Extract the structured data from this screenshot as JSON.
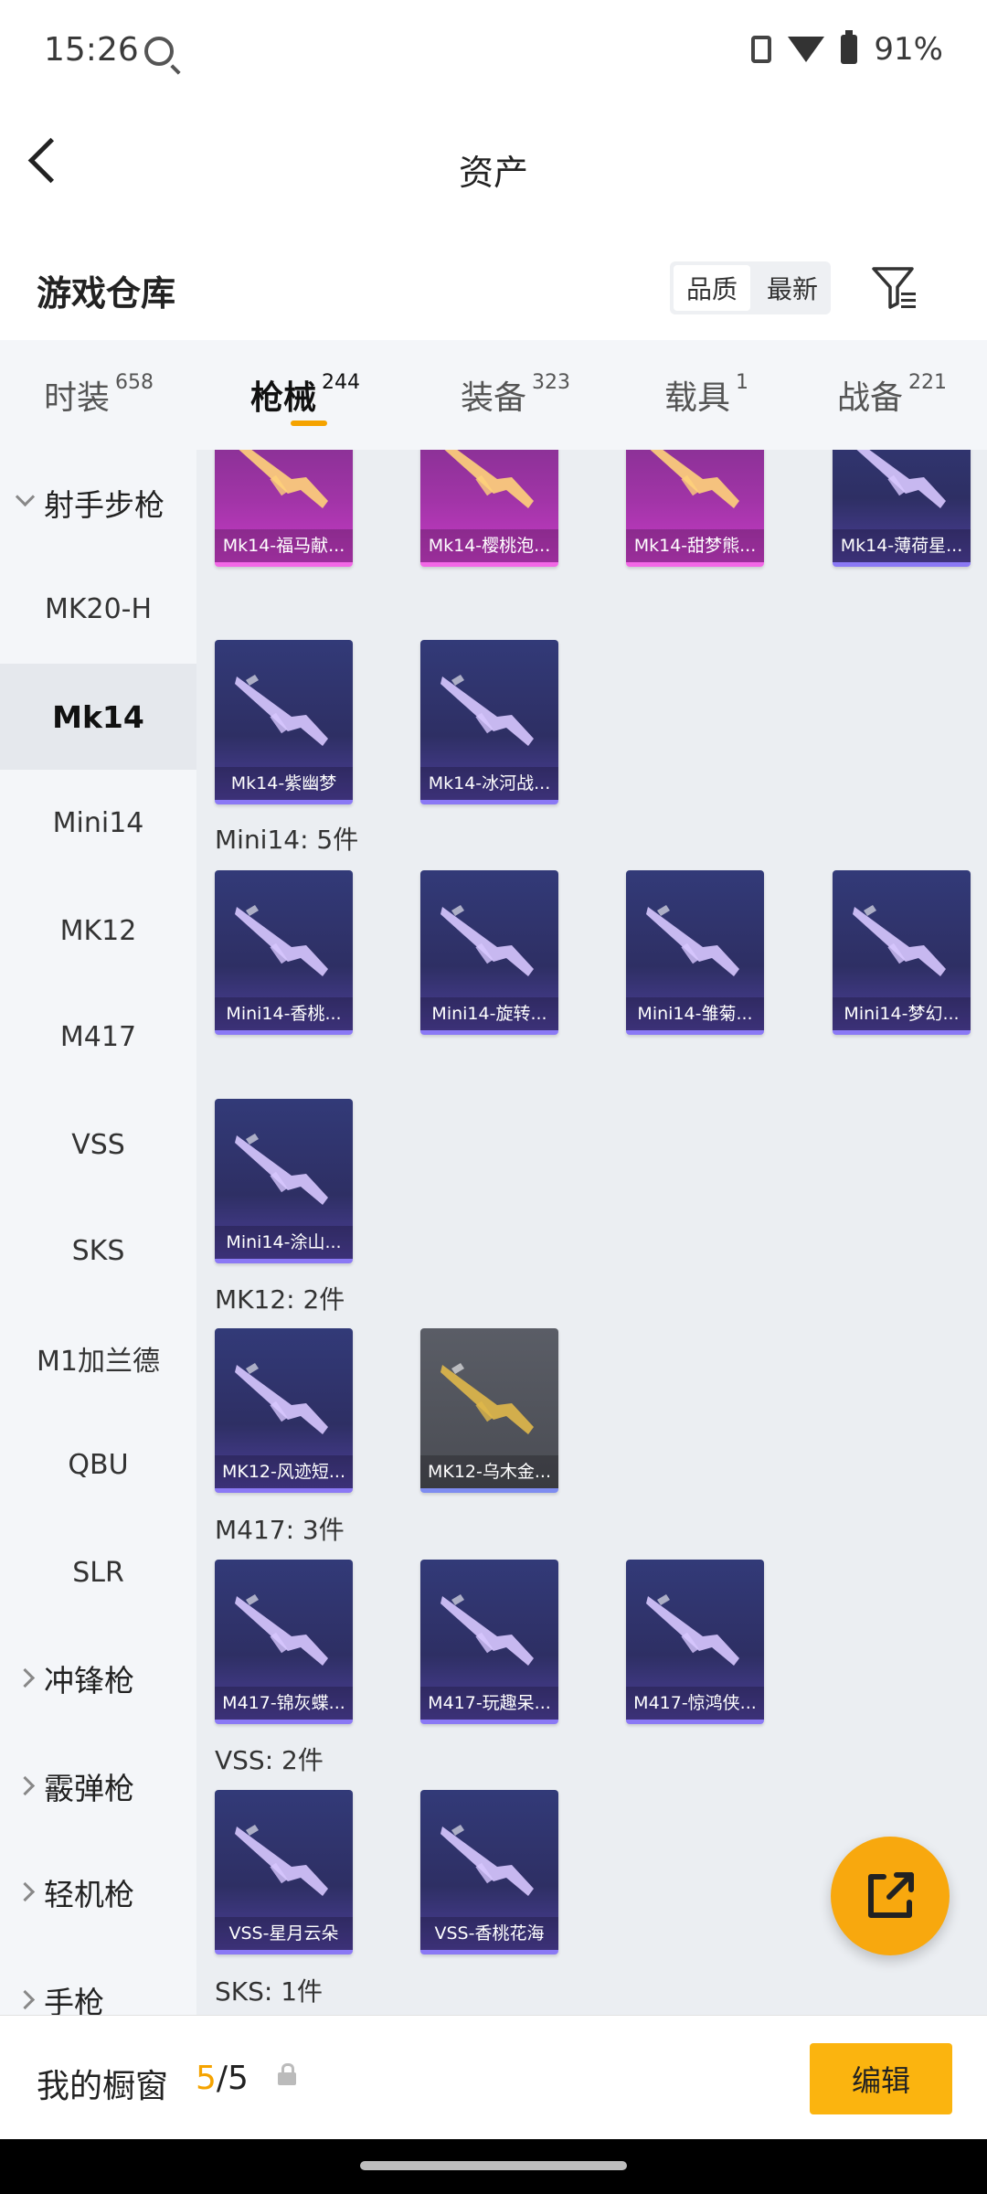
{
  "status": {
    "time": "15:26",
    "battery": "91%"
  },
  "appbar": {
    "title": "资产"
  },
  "warehouse": {
    "title": "游戏仓库",
    "sort_options": [
      "品质",
      "最新"
    ],
    "active_sort": "品质"
  },
  "tabs": [
    {
      "label": "时装",
      "count": "658"
    },
    {
      "label": "枪械",
      "count": "244",
      "active": true
    },
    {
      "label": "装备",
      "count": "323"
    },
    {
      "label": "载具",
      "count": "1"
    },
    {
      "label": "战备",
      "count": "221"
    }
  ],
  "sidebar": {
    "category_open": "射手步枪",
    "items": [
      "MK20-H",
      "Mk14",
      "Mini14",
      "MK12",
      "M417",
      "VSS",
      "SKS",
      "M1加兰德",
      "QBU",
      "SLR"
    ],
    "active_item": "Mk14",
    "collapsed_categories": [
      "冲锋枪",
      "霰弹枪",
      "轻机枪",
      "手枪"
    ]
  },
  "content": {
    "top_row": [
      {
        "name": "Mk14-福马献...",
        "rarity": "pink"
      },
      {
        "name": "Mk14-樱桃泡...",
        "rarity": "pink"
      },
      {
        "name": "Mk14-甜梦熊...",
        "rarity": "pink"
      },
      {
        "name": "Mk14-薄荷星...",
        "rarity": "blue"
      }
    ],
    "mk14_more": [
      {
        "name": "Mk14-紫幽梦",
        "rarity": "blue"
      },
      {
        "name": "Mk14-冰河战...",
        "rarity": "blue"
      }
    ],
    "sections": [
      {
        "label": "Mini14: 5件",
        "items": [
          {
            "name": "Mini14-香桃...",
            "rarity": "blue"
          },
          {
            "name": "Mini14-旋转...",
            "rarity": "blue"
          },
          {
            "name": "Mini14-雏菊...",
            "rarity": "blue"
          },
          {
            "name": "Mini14-梦幻...",
            "rarity": "blue"
          },
          {
            "name": "Mini14-涂山...",
            "rarity": "blue"
          }
        ]
      },
      {
        "label": "MK12: 2件",
        "items": [
          {
            "name": "MK12-风迹短...",
            "rarity": "blue"
          },
          {
            "name": "MK12-乌木金...",
            "rarity": "grey"
          }
        ]
      },
      {
        "label": "M417: 3件",
        "items": [
          {
            "name": "M417-锦灰蝶...",
            "rarity": "blue"
          },
          {
            "name": "M417-玩趣呆...",
            "rarity": "blue"
          },
          {
            "name": "M417-惊鸿侠...",
            "rarity": "blue"
          }
        ]
      },
      {
        "label": "VSS: 2件",
        "items": [
          {
            "name": "VSS-星月云朵",
            "rarity": "blue"
          },
          {
            "name": "VSS-香桃花海",
            "rarity": "blue"
          }
        ]
      },
      {
        "label": "SKS: 1件",
        "items": []
      }
    ]
  },
  "bottom": {
    "label": "我的橱窗",
    "current": "5",
    "separator": "/",
    "total": "5",
    "edit": "编辑"
  },
  "colors": {
    "accent": "#f5a300",
    "fab": "#f8a80e",
    "edit_button": "#fbb40f"
  }
}
